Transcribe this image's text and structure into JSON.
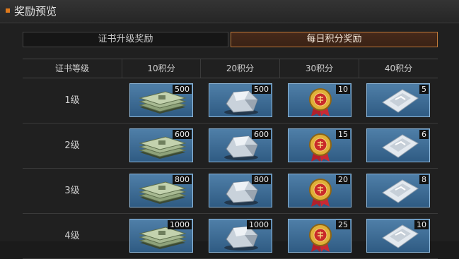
{
  "header": {
    "title": "奖励预览"
  },
  "tabs": [
    {
      "label": "证书升级奖励",
      "active": false
    },
    {
      "label": "每日积分奖励",
      "active": true
    }
  ],
  "table": {
    "columns": [
      "证书等级",
      "10积分",
      "20积分",
      "30积分",
      "40积分"
    ],
    "rows": [
      {
        "level": "1级",
        "items": [
          {
            "icon": "cash-stack-icon",
            "qty": "500"
          },
          {
            "icon": "silver-ore-icon",
            "qty": "500"
          },
          {
            "icon": "gold-medal-icon",
            "qty": "10"
          },
          {
            "icon": "crystal-pack-icon",
            "qty": "5"
          }
        ]
      },
      {
        "level": "2级",
        "items": [
          {
            "icon": "cash-stack-icon",
            "qty": "600"
          },
          {
            "icon": "silver-ore-icon",
            "qty": "600"
          },
          {
            "icon": "gold-medal-icon",
            "qty": "15"
          },
          {
            "icon": "crystal-pack-icon",
            "qty": "6"
          }
        ]
      },
      {
        "level": "3级",
        "items": [
          {
            "icon": "cash-stack-icon",
            "qty": "800"
          },
          {
            "icon": "silver-ore-icon",
            "qty": "800"
          },
          {
            "icon": "gold-medal-icon",
            "qty": "20"
          },
          {
            "icon": "crystal-pack-icon",
            "qty": "8"
          }
        ]
      },
      {
        "level": "4级",
        "items": [
          {
            "icon": "cash-stack-icon",
            "qty": "1000"
          },
          {
            "icon": "silver-ore-icon",
            "qty": "1000"
          },
          {
            "icon": "gold-medal-icon",
            "qty": "25"
          },
          {
            "icon": "crystal-pack-icon",
            "qty": "10"
          }
        ]
      }
    ]
  }
}
